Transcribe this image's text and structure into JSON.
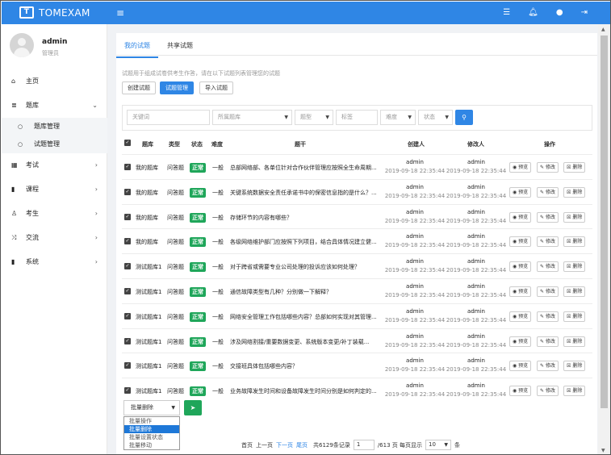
{
  "app": {
    "logo_mark": "T",
    "name": "TOMEXAM",
    "menu_icon": "menu-icon"
  },
  "topbar": {
    "icons": [
      "list-icon",
      "bell-icon",
      "user-icon",
      "logout-icon"
    ]
  },
  "user": {
    "name": "admin",
    "role": "管理员"
  },
  "sidebar": {
    "items": [
      {
        "label": "主页",
        "icon": "home-icon"
      },
      {
        "label": "题库",
        "icon": "database-icon",
        "expanded": true
      },
      {
        "label": "考试",
        "icon": "calendar-icon"
      },
      {
        "label": "课程",
        "icon": "book-icon"
      },
      {
        "label": "考生",
        "icon": "person-icon"
      },
      {
        "label": "交流",
        "icon": "shuffle-icon"
      },
      {
        "label": "系统",
        "icon": "system-icon"
      }
    ],
    "sub": [
      "题库管理",
      "试题管理"
    ]
  },
  "tabs": [
    "我的试题",
    "共享试题"
  ],
  "hint": "试题用于组成试卷供考生作答，请在以下试题列表管理您的试题",
  "buttons": {
    "create": "创建试题",
    "manage": "试题管理",
    "import": "导入试题"
  },
  "filters": {
    "keyword_placeholder": "关键词",
    "bank": "所属题库",
    "type": "题型",
    "tag_placeholder": "标签",
    "difficulty": "难度",
    "status": "状态"
  },
  "table": {
    "headers": {
      "bank": "题库",
      "type": "类型",
      "status": "状态",
      "difficulty": "难度",
      "stem": "题干",
      "creator": "创建人",
      "modifier": "修改人",
      "actions": "操作"
    },
    "rows": [
      {
        "bank": "我的题库",
        "type": "问答题",
        "status": "正常",
        "difficulty": "一般",
        "stem": "总部网络部、各单位针对合作伙伴管理应按照全生命周期...",
        "creator": "admin",
        "created": "2019-09-18 22:35:44",
        "modifier": "admin",
        "modified": "2019-09-18 22:35:44"
      },
      {
        "bank": "我的题库",
        "type": "问答题",
        "status": "正常",
        "difficulty": "一般",
        "stem": "关键系统数据安全责任承诺书中的保密信息指的是什么？...",
        "creator": "admin",
        "created": "2019-09-18 22:35:44",
        "modifier": "admin",
        "modified": "2019-09-18 22:35:44"
      },
      {
        "bank": "我的题库",
        "type": "问答题",
        "status": "正常",
        "difficulty": "一般",
        "stem": "存储环节的内容有哪些？",
        "creator": "admin",
        "created": "2019-09-18 22:35:44",
        "modifier": "admin",
        "modified": "2019-09-18 22:35:44"
      },
      {
        "bank": "我的题库",
        "type": "问答题",
        "status": "正常",
        "difficulty": "一般",
        "stem": "各级网络维护部门应按照下列项目，结合具体情况建立健...",
        "creator": "admin",
        "created": "2019-09-18 22:35:44",
        "modifier": "admin",
        "modified": "2019-09-18 22:35:44"
      },
      {
        "bank": "测试题库1",
        "type": "问答题",
        "status": "正常",
        "difficulty": "一般",
        "stem": "对于跨省或需要专业公司处理的投诉应该如何处理？",
        "creator": "admin",
        "created": "2019-09-18 22:35:44",
        "modifier": "admin",
        "modified": "2019-09-18 22:35:44"
      },
      {
        "bank": "测试题库1",
        "type": "问答题",
        "status": "正常",
        "difficulty": "一般",
        "stem": "通信故障类型有几种？分别做一下解释？",
        "creator": "admin",
        "created": "2019-09-18 22:35:44",
        "modifier": "admin",
        "modified": "2019-09-18 22:35:44"
      },
      {
        "bank": "测试题库1",
        "type": "问答题",
        "status": "正常",
        "difficulty": "一般",
        "stem": "网络安全管理工作包括哪些内容？总部如何实现对其管理...",
        "creator": "admin",
        "created": "2019-09-18 22:35:44",
        "modifier": "admin",
        "modified": "2019-09-18 22:35:44"
      },
      {
        "bank": "测试题库1",
        "type": "问答题",
        "status": "正常",
        "difficulty": "一般",
        "stem": "涉及网络割接/重要数据变更、系统版本变更/补丁装载...",
        "creator": "admin",
        "created": "2019-09-18 22:35:44",
        "modifier": "admin",
        "modified": "2019-09-18 22:35:44"
      },
      {
        "bank": "测试题库1",
        "type": "问答题",
        "status": "正常",
        "difficulty": "一般",
        "stem": "交接班具体包括哪些内容？",
        "creator": "admin",
        "created": "2019-09-18 22:35:44",
        "modifier": "admin",
        "modified": "2019-09-18 22:35:44"
      },
      {
        "bank": "测试题库1",
        "type": "问答题",
        "status": "正常",
        "difficulty": "一般",
        "stem": "业务故障发生时间和设备故障发生时间分别是如何判定的...",
        "creator": "admin",
        "created": "2019-09-18 22:35:44",
        "modifier": "admin",
        "modified": "2019-09-18 22:35:44"
      }
    ],
    "actions": {
      "preview": "预览",
      "edit": "修改",
      "delete": "删除"
    }
  },
  "batch": {
    "selected": "批量删除",
    "options": [
      "批量操作",
      "批量删除",
      "批量设置状态",
      "批量移动"
    ],
    "selected_index": 1
  },
  "pager": {
    "first": "首页",
    "prev": "上一页",
    "next": "下一页",
    "last": "尾页",
    "total": "共6129条记录",
    "page": "1",
    "pages": "/613 页 每页显示",
    "size": "10",
    "unit": "条"
  }
}
